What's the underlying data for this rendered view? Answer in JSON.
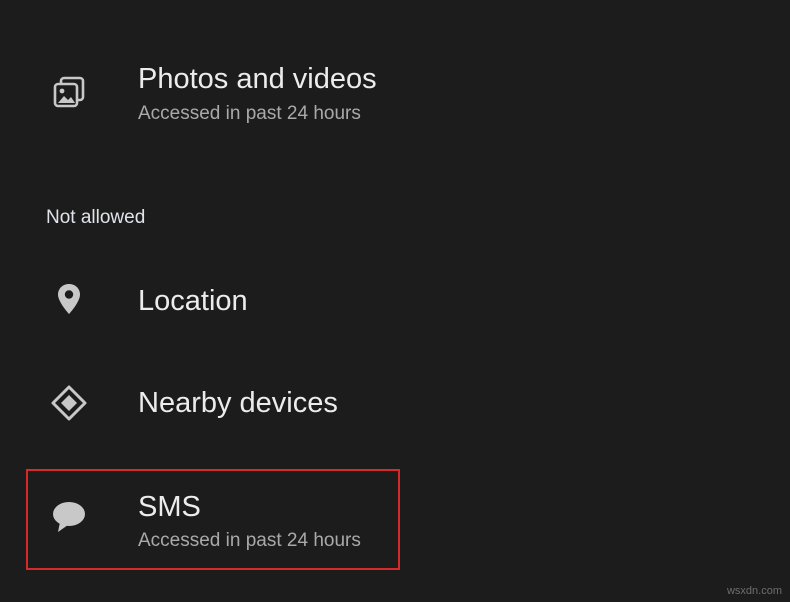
{
  "permissions_allowed": [
    {
      "label": "Photos and videos",
      "subtitle": "Accessed in past 24 hours",
      "icon": "photo-library-icon"
    }
  ],
  "section_not_allowed": "Not allowed",
  "permissions_denied": [
    {
      "label": "Location",
      "icon": "location-pin-icon"
    },
    {
      "label": "Nearby devices",
      "icon": "nearby-devices-icon"
    },
    {
      "label": "SMS",
      "subtitle": "Accessed in past 24 hours",
      "icon": "sms-bubble-icon",
      "highlighted": true
    }
  ],
  "colors": {
    "background": "#1c1c1c",
    "primary_text": "#ececec",
    "secondary_text": "#a9a9a9",
    "icon": "#c8c8c8",
    "highlight_border": "#d62a2a"
  },
  "watermark": "wsxdn.com"
}
